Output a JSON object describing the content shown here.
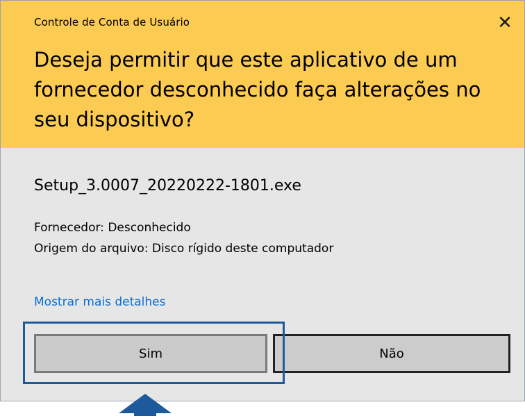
{
  "dialog": {
    "window_title": "Controle de Conta de Usuário",
    "close_glyph": "✕",
    "question": "Deseja permitir que este aplicativo de um fornecedor desconhecido faça alterações no seu dispositivo?",
    "file_name": "Setup_3.0007_20220222-1801.exe",
    "publisher": "Fornecedor: Desconhecido",
    "origin": "Origem do arquivo: Disco rígido deste computador",
    "details_link": "Mostrar mais detalhes",
    "yes_label": "Sim",
    "no_label": "Não"
  },
  "colors": {
    "header": "#fccb52",
    "body": "#e6e6e6",
    "link": "#0a6ed1",
    "highlight": "#1d5a9b"
  }
}
